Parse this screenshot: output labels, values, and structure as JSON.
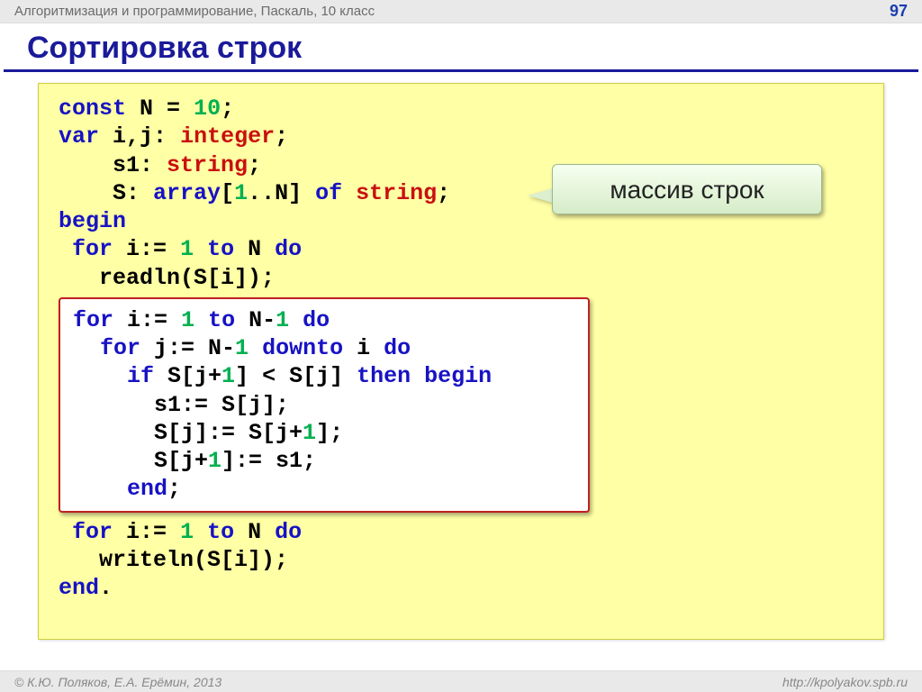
{
  "header": {
    "subject": "Алгоритмизация и программирование, Паскаль, 10 класс",
    "page": "97"
  },
  "title": "Сортировка строк",
  "callout": "массив строк",
  "code": {
    "l1a": "const",
    "l1b": "N =",
    "l1n": "10",
    "l1c": ";",
    "l2a": "var",
    "l2b": "i,j:",
    "l2c": "integer",
    "l2d": ";",
    "l3a": "    s1:",
    "l3b": "string",
    "l3c": ";",
    "l4a": "    S:",
    "l4b": "array",
    "l4c": "[",
    "l4n": "1",
    "l4d": "..N]",
    "l4e": "of",
    "l4f": "string",
    "l4g": ";",
    "l5": "begin",
    "l6a": " for",
    "l6b": "i:=",
    "l6n": "1",
    "l6c": "to",
    "l6d": "N",
    "l6e": "do",
    "l7": "   readln(S[i]);",
    "i1a": "for",
    "i1b": "i:=",
    "i1n": "1",
    "i1c": "to",
    "i1d": "N-",
    "i1n2": "1",
    "i1e": "do",
    "i2a": "  for",
    "i2b": "j:= N-",
    "i2n": "1",
    "i2c": "downto",
    "i2d": "i",
    "i2e": "do",
    "i3a": "    if",
    "i3b": "S[j+",
    "i3n": "1",
    "i3c": "] < S[j]",
    "i3d": "then begin",
    "i4": "      s1:= S[j];",
    "i5a": "      S[j]:= S[j+",
    "i5n": "1",
    "i5b": "];",
    "i6a": "      S[j+",
    "i6n": "1",
    "i6b": "]:= s1;",
    "i7": "    end",
    "l8a": " for",
    "l8b": "i:=",
    "l8n": "1",
    "l8c": "to",
    "l8d": "N",
    "l8e": "do",
    "l9": "   writeln(S[i]);",
    "l10": "end"
  },
  "footer": {
    "left": "© К.Ю. Поляков, Е.А. Ерёмин, 2013",
    "right": "http://kpolyakov.spb.ru"
  }
}
